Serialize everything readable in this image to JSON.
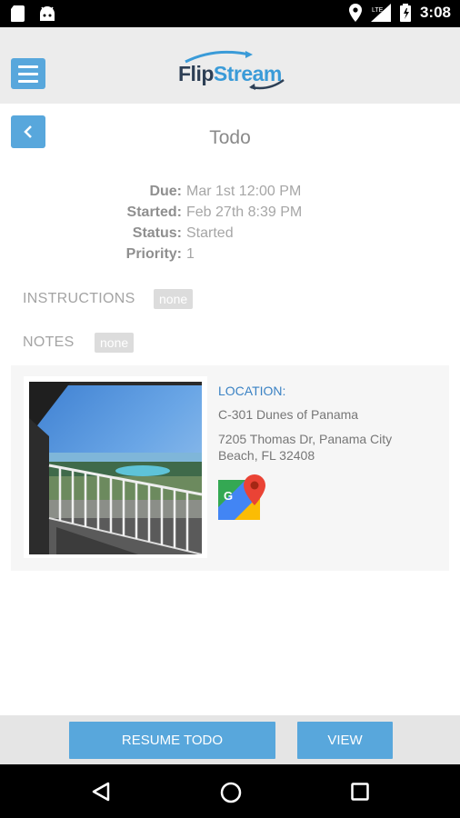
{
  "status_bar": {
    "time": "3:08",
    "network": "LTE"
  },
  "header": {
    "logo_part1": "Flip",
    "logo_part2": "Stream"
  },
  "page": {
    "title": "Todo"
  },
  "details": {
    "due_label": "Due:",
    "due_value": "Mar 1st 12:00 PM",
    "started_label": "Started:",
    "started_value": "Feb 27th 8:39 PM",
    "status_label": "Status:",
    "status_value": "Started",
    "priority_label": "Priority:",
    "priority_value": "1"
  },
  "instructions": {
    "label": "INSTRUCTIONS",
    "value": "none"
  },
  "notes": {
    "label": "NOTES",
    "value": "none"
  },
  "location": {
    "label": "LOCATION:",
    "name": "C-301 Dunes of Panama",
    "address": "7205 Thomas Dr, Panama City Beach, FL 32408"
  },
  "actions": {
    "resume": "RESUME TODO",
    "view": "VIEW"
  },
  "colors": {
    "accent": "#58a7dc",
    "logo_dark": "#2d3f55",
    "logo_blue": "#3a9bd8"
  }
}
